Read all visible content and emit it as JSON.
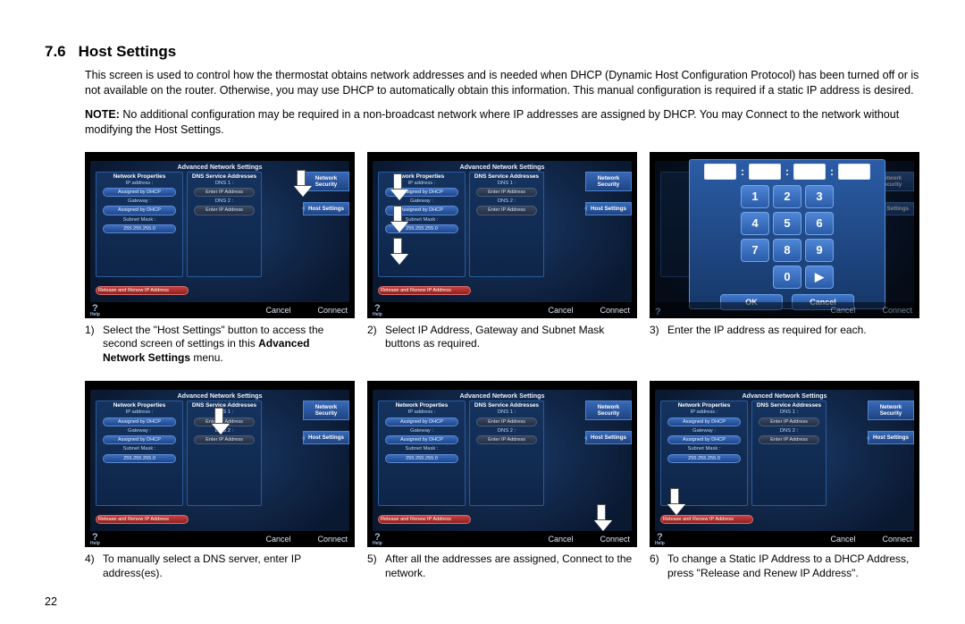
{
  "section_number": "7.6",
  "section_title": "Host Settings",
  "intro_text": "This screen is used to control how the thermostat obtains network addresses and is needed when DHCP (Dynamic Host Configuration Protocol) has been turned off or is not available on the router. Otherwise, you may use DHCP to automatically obtain this information. This manual configuration is required if a static IP address is desired.",
  "note_label": "NOTE:",
  "note_text": "No additional configuration may be required in a non-broadcast network where IP addresses are assigned by DHCP. You may Connect to the network without modifying the Host Settings.",
  "screen": {
    "title": "Advanced Network Settings",
    "left_panel_head": "Network Properties",
    "mid_panel_head": "DNS Service Addresses",
    "ip_label": "IP address :",
    "assigned": "Assigned by DHCP",
    "gateway_label": "Gateway :",
    "subnet_label": "Subnet Mask :",
    "subnet_value": "255.255.255.0",
    "dns1": "DNS 1 :",
    "dns2": "DNS 2 :",
    "enter_ip": "Enter IP Address",
    "release": "Release and Renew IP Address",
    "tab_network": "Network Security",
    "tab_host": "Host Settings",
    "help": "?",
    "help_label": "Help",
    "cancel": "Cancel",
    "connect": "Connect"
  },
  "keypad": {
    "keys": [
      "1",
      "2",
      "3",
      "4",
      "5",
      "6",
      "7",
      "8",
      "9",
      "",
      "0",
      "▶"
    ],
    "ok": "OK",
    "cancel": "Cancel"
  },
  "captions": {
    "c1_num": "1)",
    "c1a": "Select the \"Host Settings\" button to access the second screen of settings in this ",
    "c1b": "Advanced Network Settings",
    "c1c": " menu.",
    "c2_num": "2)",
    "c2": "Select IP Address, Gateway and Subnet Mask buttons as required.",
    "c3_num": "3)",
    "c3": "Enter the IP address as required for each.",
    "c4_num": "4)",
    "c4": "To manually select a DNS server, enter IP address(es).",
    "c5_num": "5)",
    "c5": "After all the addresses are assigned, Connect to the network.",
    "c6_num": "6)",
    "c6": "To change a Static IP Address to a DHCP Address, press \"Release and Renew IP Address\"."
  },
  "page_number": "22"
}
